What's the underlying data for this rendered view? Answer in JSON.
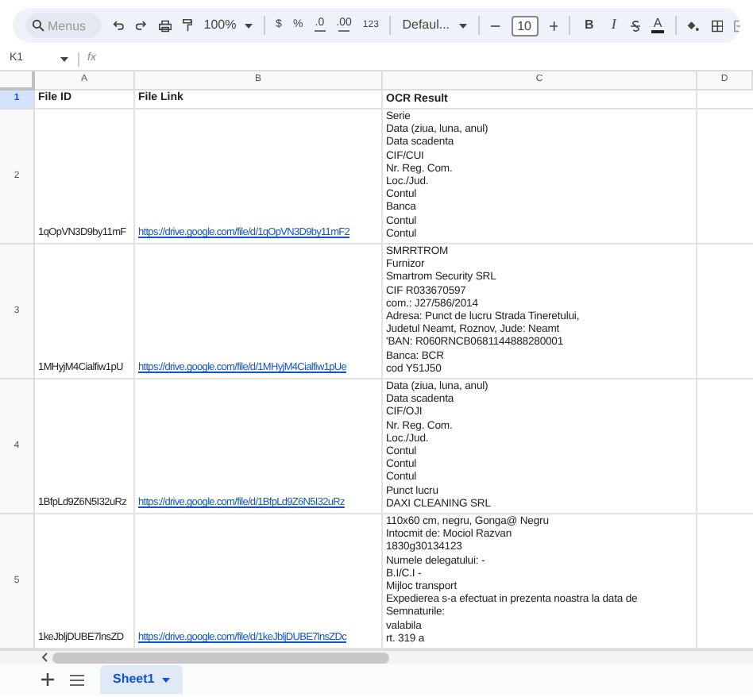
{
  "toolbar": {
    "search_placeholder": "Menus",
    "zoom": "100%",
    "currency": "$",
    "percent": "%",
    "decrease_decimal": ".0",
    "increase_decimal": ".00",
    "number_format": "123",
    "font": "Defaul...",
    "font_size": "10",
    "bold": "B",
    "italic": "I",
    "text_color": "A"
  },
  "name_box": "K1",
  "formula_label": "fx",
  "columns": [
    "A",
    "B",
    "C",
    "D"
  ],
  "rows": [
    {
      "kind": "header",
      "number": "1",
      "selected": true,
      "file_id": "File ID",
      "file_link": "File Link",
      "ocr": [
        "OCR Result"
      ]
    },
    {
      "kind": "data",
      "number": "2",
      "selected": false,
      "file_id": "1qOpVN3D9by11mF",
      "file_link": "https://drive.google.com/file/d/1qOpVN3D9by11mF2",
      "ocr": [
        "Serie",
        "Data (ziua, luna, anul)",
        "Data scadenta",
        "CIF/CUI",
        "Nr. Reg. Com.",
        "Loc./Jud.",
        "Contul",
        "Banca",
        "Contul",
        "Contul"
      ]
    },
    {
      "kind": "data",
      "number": "3",
      "selected": false,
      "file_id": "1MHyjM4Cialfiw1pU",
      "file_link": "https://drive.google.com/file/d/1MHyjM4Cialfiw1pUe",
      "ocr": [
        "SMRRTROM",
        "Furnizor",
        "Smartrom Security SRL",
        "CIF R033670597",
        "com.: J27/586/2014",
        "Adresa: Punct de lucru Strada Tineretului,",
        "Judetul Neamt, Roznov, Jude: Neamt",
        "'BAN: R060RNCB0681144888280001",
        "Banca: BCR",
        "cod Y51J50"
      ]
    },
    {
      "kind": "data",
      "number": "4",
      "selected": false,
      "file_id": "1BfpLd9Z6N5I32uRz",
      "file_link": "https://drive.google.com/file/d/1BfpLd9Z6N5I32uRz",
      "ocr": [
        "Data (ziua, luna, anul)",
        "Data scadenta",
        "CIF/OJI",
        "Nr. Reg. Com.",
        "Loc./Jud.",
        "Contul",
        "Contul",
        "Contul",
        "Punct lucru",
        "DAXI CLEANING SRL"
      ]
    },
    {
      "kind": "data",
      "number": "5",
      "selected": false,
      "file_id": "1keJbljDUBE7lnsZD",
      "file_link": "https://drive.google.com/file/d/1keJbljDUBE7lnsZDc",
      "ocr": [
        "110x60 cm, negru, Gonga@ Negru",
        "Intocmit de: Mociol Razvan",
        "1830g30134123",
        "Numele delegatului: -",
        "B.I/C.I -",
        "Mijloc transport",
        "Expedierea s-a efectuat in prezenta noastra la data de",
        "Semnaturile:",
        "valabila",
        "rt. 319 a"
      ]
    }
  ],
  "sheets": [
    {
      "label": "Sheet1",
      "selected": true
    }
  ]
}
